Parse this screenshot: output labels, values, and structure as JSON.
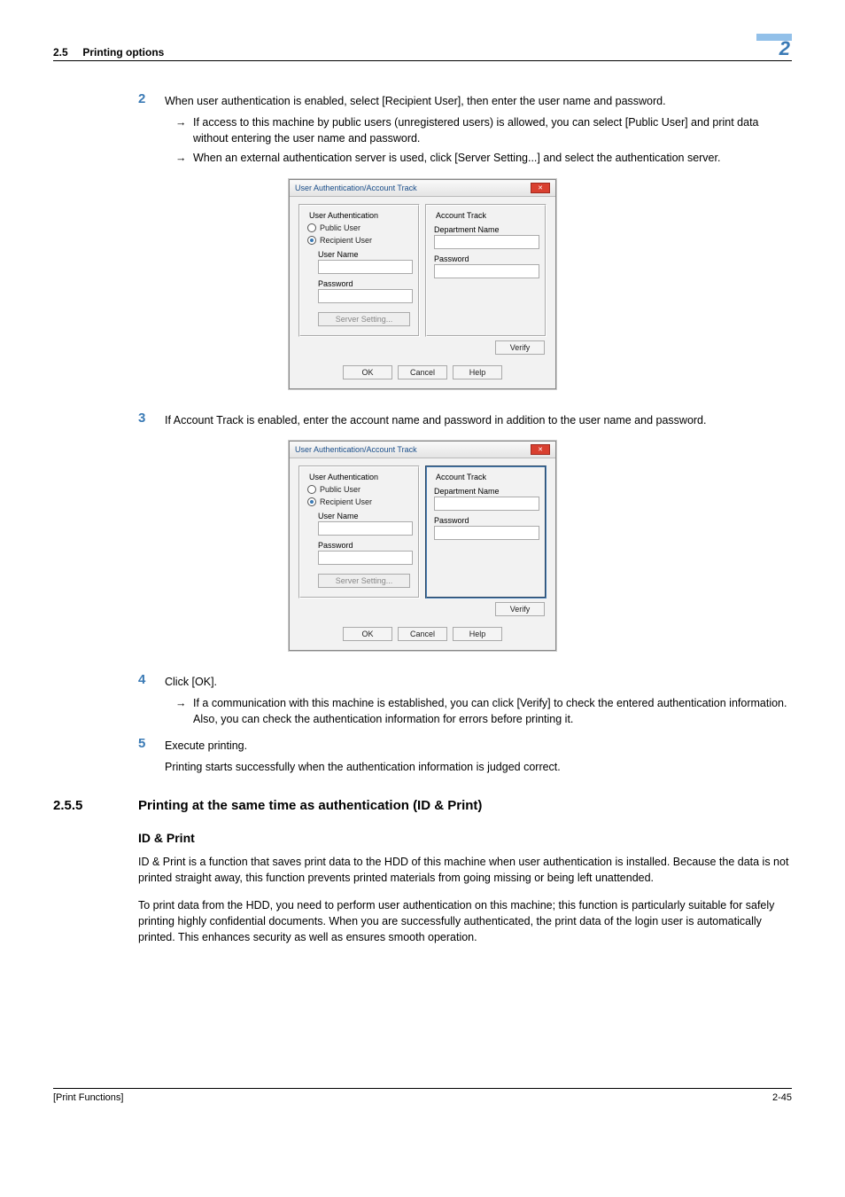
{
  "header": {
    "section_num": "2.5",
    "section_title": "Printing options",
    "chapter_num": "2"
  },
  "steps": {
    "s2": {
      "num": "2",
      "text": "When user authentication is enabled, select [Recipient User], then enter the user name and password.",
      "b1": "If access to this machine by public users (unregistered users) is allowed, you can select [Public User] and print data without entering the user name and password.",
      "b2": "When an external authentication server is used, click [Server Setting...] and select the authentication server."
    },
    "s3": {
      "num": "3",
      "text": "If Account Track is enabled, enter the account name and password in addition to the user name and password."
    },
    "s4": {
      "num": "4",
      "text": "Click [OK].",
      "b1": "If a communication with this machine is established, you can click [Verify] to check the entered authentication information. Also, you can check the authentication information for errors before printing it."
    },
    "s5": {
      "num": "5",
      "text": "Execute printing.",
      "follow": "Printing starts successfully when the authentication information is judged correct."
    }
  },
  "dialog": {
    "title": "User Authentication/Account Track",
    "ua_title": "User Authentication",
    "at_title": "Account Track",
    "public_user": "Public User",
    "recipient_user": "Recipient User",
    "user_name": "User Name",
    "password_u": "Password",
    "server_setting": "Server Setting...",
    "dept_name": "Department Name",
    "password_a": "Password",
    "verify": "Verify",
    "ok": "OK",
    "cancel": "Cancel",
    "help": "Help"
  },
  "section": {
    "num": "2.5.5",
    "title": "Printing at the same time as authentication (ID & Print)"
  },
  "subhead": "ID & Print",
  "para1": "ID & Print is a function that saves print data to the HDD of this machine when user authentication is installed. Because the data is not printed straight away, this function prevents printed materials from going missing or being left unattended.",
  "para2": "To print data from the HDD, you need to perform user authentication on this machine; this function is particularly suitable for safely printing highly confidential documents. When you are successfully authenticated, the print data of the login user is automatically printed. This enhances security as well as ensures smooth operation.",
  "footer": {
    "left": "[Print Functions]",
    "right": "2-45"
  }
}
